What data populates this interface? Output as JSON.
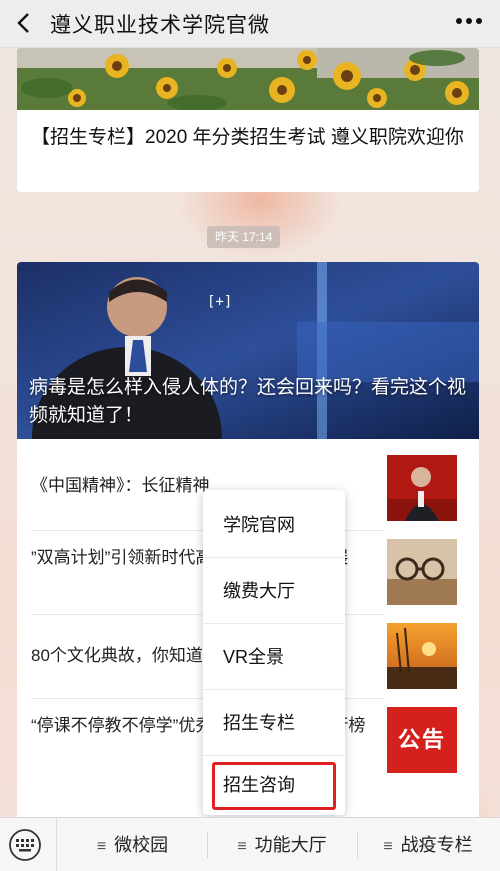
{
  "header": {
    "title": "遵义职业技术学院官微"
  },
  "feed": {
    "card1_title": "【招生专栏】2020 年分类招生考试 遵义职院欢迎你",
    "timestamp": "昨天 17:14",
    "hero_title": "病毒是怎么样入侵人体的？还会回来吗？看完这个视频就知道了！",
    "hero_badge": "[+]",
    "articles": [
      {
        "title": "《中国精神》：长征精神"
      },
      {
        "title": "”双高计划”引领新时代高职院校高质量发展"
      },
      {
        "title": "80个文化典故，你知道几个？"
      },
      {
        "title": "“停课不停教不停学”优秀在线课程点赞排行榜"
      }
    ],
    "notice_badge": "公告"
  },
  "popup_menu": {
    "items": [
      "学院官网",
      "缴费大厅",
      "VR全景",
      "招生专栏",
      "招生咨询"
    ],
    "highlighted": "招生咨询"
  },
  "bottom_menu": {
    "items": [
      {
        "label": "微校园"
      },
      {
        "label": "功能大厅"
      },
      {
        "label": "战疫专栏"
      }
    ]
  },
  "colors": {
    "highlight": "#e02020",
    "notice_red": "#d5211c"
  }
}
